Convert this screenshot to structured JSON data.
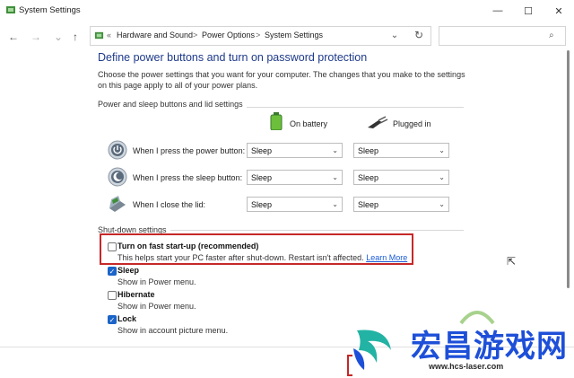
{
  "window": {
    "title": "System Settings"
  },
  "nav": {
    "back": "←",
    "forward": "→",
    "up": "↑"
  },
  "breadcrumb": {
    "chev": "«",
    "items": [
      "Hardware and Sound",
      "Power Options",
      "System Settings"
    ],
    "separator": ">"
  },
  "search": {
    "placeholder": ""
  },
  "page": {
    "heading": "Define power buttons and turn on password protection",
    "description": "Choose the power settings that you want for your computer. The changes that you make to the settings on this page apply to all of your power plans."
  },
  "power_section": {
    "label": "Power and sleep buttons and lid settings",
    "col_battery": "On battery",
    "col_plugged": "Plugged in",
    "rows": [
      {
        "label": "When I press the power button:",
        "battery": "Sleep",
        "plugged": "Sleep",
        "icon": "power-icon"
      },
      {
        "label": "When I press the sleep button:",
        "battery": "Sleep",
        "plugged": "Sleep",
        "icon": "sleep-icon"
      },
      {
        "label": "When I close the lid:",
        "battery": "Sleep",
        "plugged": "Sleep",
        "icon": "laptop-lid-icon"
      }
    ]
  },
  "shutdown_section": {
    "label": "Shut-down settings",
    "options": [
      {
        "label": "Turn on fast start-up (recommended)",
        "desc": "This helps start your PC faster after shut-down. Restart isn't affected.",
        "link": "Learn More",
        "checked": false
      },
      {
        "label": "Sleep",
        "desc": "Show in Power menu.",
        "checked": true
      },
      {
        "label": "Hibernate",
        "desc": "Show in Power menu.",
        "checked": false
      },
      {
        "label": "Lock",
        "desc": "Show in account picture menu.",
        "checked": true
      }
    ]
  },
  "watermark": {
    "text": "宏昌游戏网",
    "url": "www.hcs-laser.com"
  },
  "colors": {
    "accent": "#1b64c8",
    "heading": "#1e3a8a",
    "highlight": "#c62828",
    "link": "#1a5bd8"
  }
}
